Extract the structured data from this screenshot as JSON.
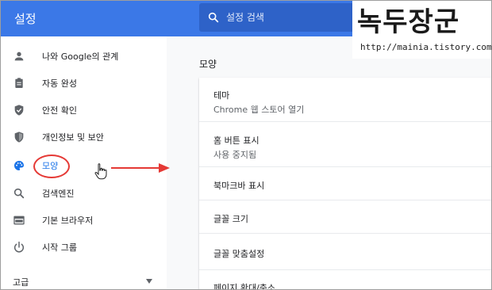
{
  "header": {
    "app_title": "설정",
    "search_placeholder": "설정 검색"
  },
  "watermark": {
    "title": "녹두장군",
    "url": "http://mainia.tistory.com"
  },
  "sidebar": {
    "items": [
      {
        "label": "나와 Google의 관계",
        "icon": "person-icon"
      },
      {
        "label": "자동 완성",
        "icon": "clipboard-icon"
      },
      {
        "label": "안전 확인",
        "icon": "shield-check-icon"
      },
      {
        "label": "개인정보 및 보안",
        "icon": "shield-icon"
      },
      {
        "label": "모양",
        "icon": "palette-icon",
        "active": true
      },
      {
        "label": "검색엔진",
        "icon": "search-icon"
      },
      {
        "label": "기본 브라우저",
        "icon": "browser-icon"
      },
      {
        "label": "시작 그룹",
        "icon": "power-icon"
      }
    ],
    "advanced_label": "고급"
  },
  "main": {
    "section_title": "모양",
    "rows": [
      {
        "primary": "테마",
        "secondary": "Chrome 웹 스토어 열기"
      },
      {
        "primary": "홈 버튼 표시",
        "secondary": "사용 중지됨"
      },
      {
        "primary": "북마크바 표시"
      },
      {
        "primary": "글꼴 크기"
      },
      {
        "primary": "글꼴 맞춤설정"
      },
      {
        "primary": "페이지 확대/축소"
      }
    ]
  },
  "colors": {
    "header": "#3b78e7",
    "active": "#1a73e8",
    "annotation": "#e53935"
  }
}
